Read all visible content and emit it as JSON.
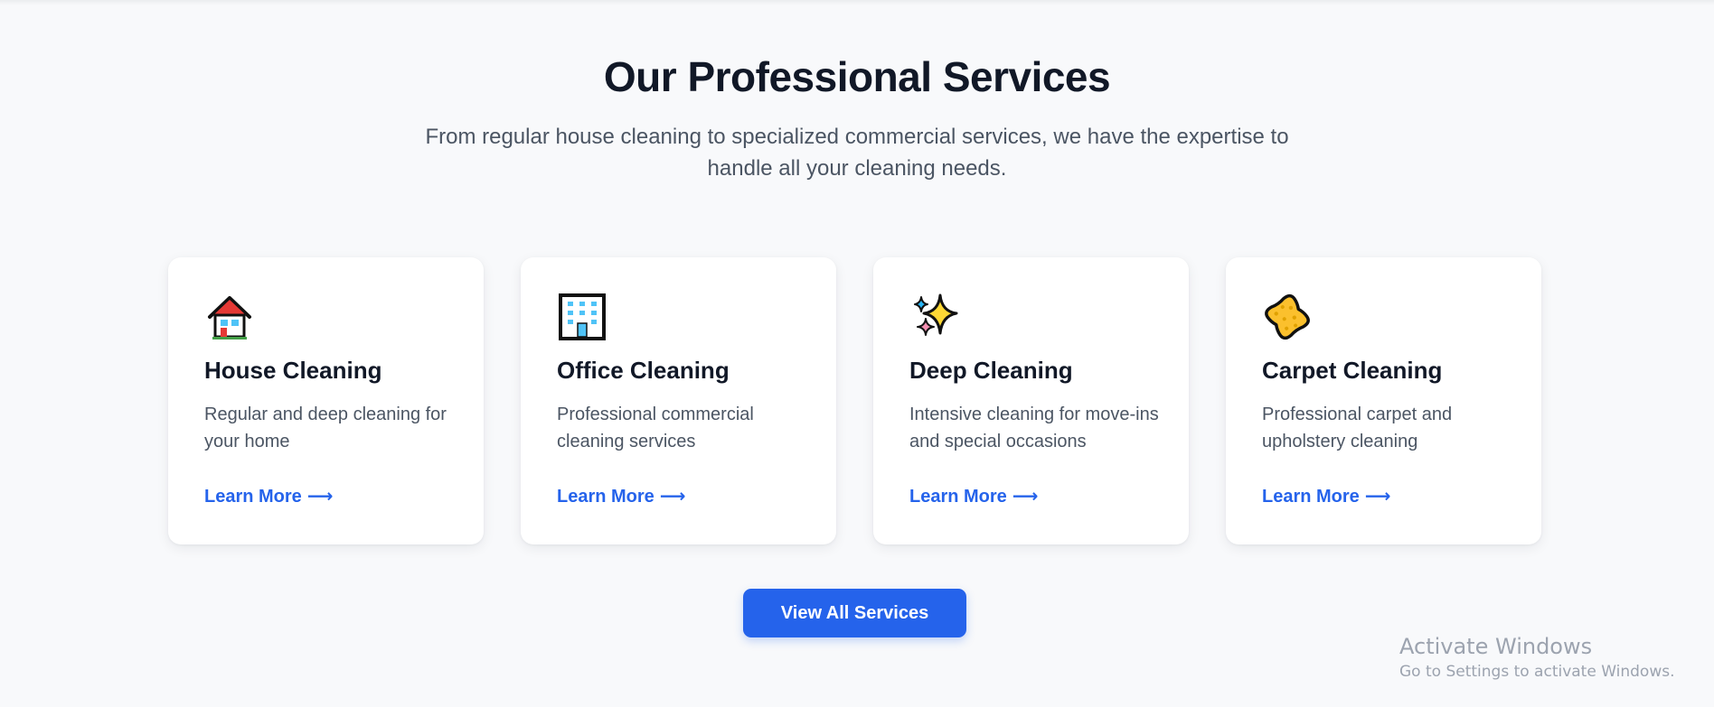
{
  "section": {
    "title": "Our Professional Services",
    "subtitle": "From regular house cleaning to specialized commercial services, we have the expertise to handle all your cleaning needs."
  },
  "services": [
    {
      "icon": "house-icon",
      "title": "House Cleaning",
      "description": "Regular and deep cleaning for your home",
      "link": "Learn More",
      "arrow": "⟶"
    },
    {
      "icon": "office-building-icon",
      "title": "Office Cleaning",
      "description": "Professional commercial cleaning services",
      "link": "Learn More",
      "arrow": "⟶"
    },
    {
      "icon": "sparkles-icon",
      "title": "Deep Cleaning",
      "description": "Intensive cleaning for move-ins and special occasions",
      "link": "Learn More",
      "arrow": "⟶"
    },
    {
      "icon": "sponge-icon",
      "title": "Carpet Cleaning",
      "description": "Professional carpet and upholstery cleaning",
      "link": "Learn More",
      "arrow": "⟶"
    }
  ],
  "cta": {
    "label": "View All Services"
  },
  "watermark": {
    "title": "Activate Windows",
    "subtitle": "Go to Settings to activate Windows."
  },
  "colors": {
    "accent": "#2563eb",
    "heading": "#111827",
    "body_text": "#4b5563",
    "background": "#f8f9fb",
    "card": "#ffffff"
  }
}
